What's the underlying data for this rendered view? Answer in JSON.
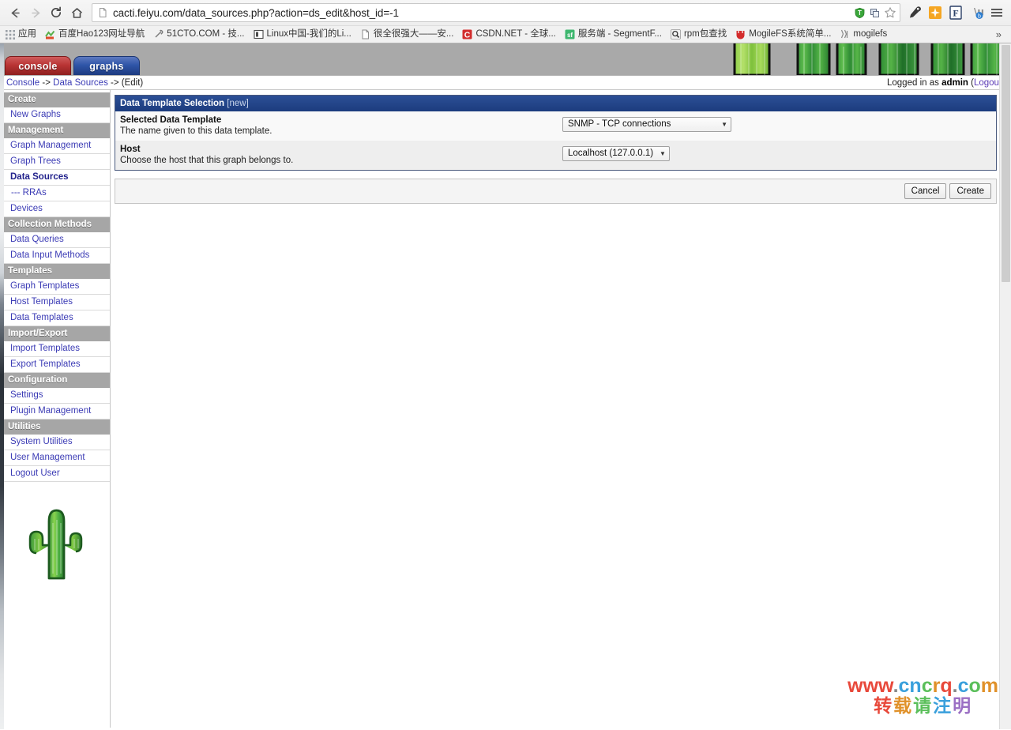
{
  "browser": {
    "back_icon": "back-arrow-icon",
    "forward_icon": "forward-arrow-icon",
    "reload_icon": "reload-icon",
    "home_icon": "home-icon",
    "url": "cacti.feiyu.com/data_sources.php?action=ds_edit&host_id=-1",
    "urlbar_icons": [
      "shield-icon",
      "copy-icon",
      "star-icon"
    ],
    "extension_icons": [
      "pen-icon",
      "sun-icon",
      "f-icon",
      "translate-icon",
      "menu-icon"
    ],
    "overflow_label": "»",
    "bookmarks": [
      {
        "icon": "apps-grid-icon",
        "label": "应用"
      },
      {
        "icon": "hao123-icon",
        "label": "百度Hao123网址导航"
      },
      {
        "icon": "link-icon",
        "label": "51CTO.COM - 技..."
      },
      {
        "icon": "book-icon",
        "label": "Linux中国-我们的Li..."
      },
      {
        "icon": "page-icon",
        "label": "很全很强大——安..."
      },
      {
        "icon": "csdn-icon",
        "label": "CSDN.NET - 全球..."
      },
      {
        "icon": "segmentfault-icon",
        "label": "服务端 - SegmentF..."
      },
      {
        "icon": "search-icon",
        "label": "rpm包查找"
      },
      {
        "icon": "mogilefs-icon",
        "label": "MogileFS系统简单..."
      },
      {
        "icon": "bookmark-icon",
        "label": "mogilefs"
      }
    ]
  },
  "header": {
    "tabs": [
      {
        "id": "console",
        "label": "console",
        "active": true
      },
      {
        "id": "graphs",
        "label": "graphs",
        "active": false
      }
    ],
    "banner_icon": "cactus-banner-image"
  },
  "breadcrumb": {
    "console": "Console",
    "sep1": " -> ",
    "data_sources": "Data Sources",
    "sep2": " -> ",
    "current": "(Edit)"
  },
  "login": {
    "prefix": "Logged in as ",
    "user": "admin",
    "open_paren": " (",
    "logout": "Logout",
    "close_paren": ")"
  },
  "sidebar": {
    "logo_icon": "cactus-logo-icon",
    "groups": [
      {
        "heading": "Create",
        "items": [
          {
            "label": "New Graphs",
            "current": false,
            "sub": false
          }
        ]
      },
      {
        "heading": "Management",
        "items": [
          {
            "label": "Graph Management",
            "current": false,
            "sub": false
          },
          {
            "label": "Graph Trees",
            "current": false,
            "sub": false
          },
          {
            "label": "Data Sources",
            "current": true,
            "sub": false
          },
          {
            "label": "--- RRAs",
            "current": false,
            "sub": true
          },
          {
            "label": "Devices",
            "current": false,
            "sub": false
          }
        ]
      },
      {
        "heading": "Collection Methods",
        "items": [
          {
            "label": "Data Queries",
            "current": false,
            "sub": false
          },
          {
            "label": "Data Input Methods",
            "current": false,
            "sub": false
          }
        ]
      },
      {
        "heading": "Templates",
        "items": [
          {
            "label": "Graph Templates",
            "current": false,
            "sub": false
          },
          {
            "label": "Host Templates",
            "current": false,
            "sub": false
          },
          {
            "label": "Data Templates",
            "current": false,
            "sub": false
          }
        ]
      },
      {
        "heading": "Import/Export",
        "items": [
          {
            "label": "Import Templates",
            "current": false,
            "sub": false
          },
          {
            "label": "Export Templates",
            "current": false,
            "sub": false
          }
        ]
      },
      {
        "heading": "Configuration",
        "items": [
          {
            "label": "Settings",
            "current": false,
            "sub": false
          },
          {
            "label": "Plugin Management",
            "current": false,
            "sub": false
          }
        ]
      },
      {
        "heading": "Utilities",
        "items": [
          {
            "label": "System Utilities",
            "current": false,
            "sub": false
          },
          {
            "label": "User Management",
            "current": false,
            "sub": false
          },
          {
            "label": "Logout User",
            "current": false,
            "sub": false
          }
        ]
      }
    ]
  },
  "main": {
    "panel_title": "Data Template Selection",
    "panel_title_sub": "[new]",
    "fields": [
      {
        "label": "Selected Data Template",
        "desc": "The name given to this data template.",
        "value": "SNMP - TCP connections",
        "caret": "▼"
      },
      {
        "label": "Host",
        "desc": "Choose the host that this graph belongs to.",
        "value": "Localhost (127.0.0.1)",
        "caret": "▼"
      }
    ],
    "buttons": [
      {
        "id": "cancel",
        "label": "Cancel"
      },
      {
        "id": "create",
        "label": "Create"
      }
    ]
  },
  "watermark": {
    "line1": "www.cncrq.com",
    "line2": "转载请注明",
    "line1_colors": [
      "#e8493b",
      "#e8493b",
      "#e8493b",
      "#888888",
      "#3aa0dc",
      "#3aa0dc",
      "#5bbf5b",
      "#e0912a",
      "#e8493b",
      "#888888",
      "#3aa0dc",
      "#5bbf5b",
      "#e0912a"
    ],
    "line2_colors": [
      "#e8493b",
      "#e0912a",
      "#5bbf5b",
      "#3aa0dc",
      "#9b6fc4",
      "#e8493b"
    ]
  },
  "colors": {
    "panel_header": "#1c3c7e",
    "tab_console": "#b93434",
    "tab_graphs": "#2f55a8",
    "nav_heading": "#a6a6a6",
    "link": "#3b3bb5"
  }
}
